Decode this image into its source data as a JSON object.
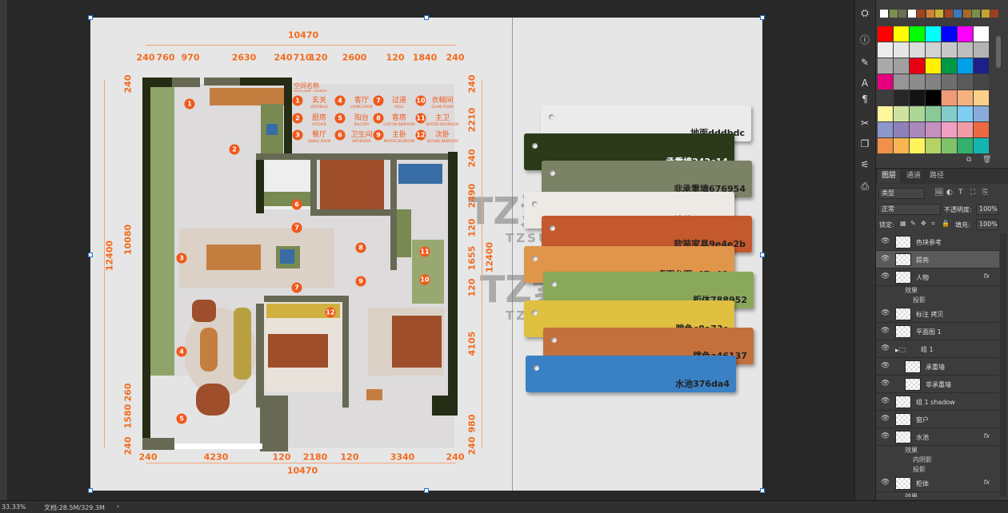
{
  "status_bar": {
    "zoom": "33.33%",
    "doc_size": "文档:28.5M/329.3M"
  },
  "plan": {
    "dims_top_total": "10470",
    "dims_top": [
      "240",
      "760",
      "970",
      "2630",
      "240",
      "710",
      "120",
      "2600",
      "120",
      "1840",
      "240"
    ],
    "dims_bottom_total": "10470",
    "dims_bottom": [
      "240",
      "4230",
      "120",
      "2180",
      "120",
      "3340",
      "240"
    ],
    "dims_left_total": "12400",
    "dims_left": [
      "240",
      "10080",
      "260",
      "1580",
      "240"
    ],
    "dims_right_total": "12400",
    "dims_right": [
      "240",
      "2210",
      "240",
      "2490",
      "120",
      "1655",
      "120",
      "4105",
      "980",
      "240"
    ],
    "room_numbers": [
      "1",
      "2",
      "3",
      "4",
      "5",
      "6",
      "7",
      "7",
      "8",
      "9",
      "10",
      "11",
      "12"
    ],
    "legend": {
      "title": "空间名称",
      "subtitle": "SPACE NAME / NUMBER",
      "items": [
        {
          "n": "1",
          "cn": "玄关",
          "en": "VESTIBULE"
        },
        {
          "n": "4",
          "cn": "客厅",
          "en": "LIVING ROOM"
        },
        {
          "n": "7",
          "cn": "过道",
          "en": "AISLE"
        },
        {
          "n": "10",
          "cn": "衣帽间",
          "en": "CLOAK ROOM"
        },
        {
          "n": "2",
          "cn": "厨房",
          "en": "KITCHEN"
        },
        {
          "n": "5",
          "cn": "阳台",
          "en": "BALCONY"
        },
        {
          "n": "8",
          "cn": "客房",
          "en": "CUSTOM BEDROOM"
        },
        {
          "n": "11",
          "cn": "主卫",
          "en": "MASTER BATHROOM"
        },
        {
          "n": "3",
          "cn": "餐厅",
          "en": "DINING ROOM"
        },
        {
          "n": "6",
          "cn": "卫生间",
          "en": "BATHROOM"
        },
        {
          "n": "9",
          "cn": "主卧",
          "en": "MASTER BEDROOM"
        },
        {
          "n": "12",
          "cn": "次卧",
          "en": "SECOND BEDROOM"
        }
      ]
    }
  },
  "swatch_cards": [
    {
      "label": "地面dddbdc",
      "color": "#ebebeb",
      "text": "#222"
    },
    {
      "label": "承重墙242c14",
      "color": "#2c3a1a",
      "text": "#fff"
    },
    {
      "label": "非承重墙676954",
      "color": "#7b8265",
      "text": "#222"
    },
    {
      "label": "地毯dbd1c7",
      "color": "#ede9e5",
      "text": "#222"
    },
    {
      "label": "软装家具9e4e2b",
      "color": "#c4592d",
      "text": "#222"
    },
    {
      "label": "桌面台面c47e40",
      "color": "#e0964a",
      "text": "#222"
    },
    {
      "label": "柜体788952",
      "color": "#8aa85a",
      "text": "#222"
    },
    {
      "label": "跳色c8a73c",
      "color": "#e0c040",
      "text": "#222"
    },
    {
      "label": "跳色a46137",
      "color": "#c4703d",
      "text": "#222"
    },
    {
      "label": "水池376da4",
      "color": "#3a80c4",
      "text": "#222"
    }
  ],
  "watermark": {
    "logo": "TZ素材网",
    "url": "TZSUCAI.COM"
  },
  "recent_swatches": [
    "#ffffff",
    "#7a8f4e",
    "#6b6f55",
    "#ffffff",
    "#a0461e",
    "#d0823a",
    "#d0b030",
    "#a04420",
    "#3a78c0",
    "#a86828",
    "#7a9048",
    "#c8a030",
    "#9e4020"
  ],
  "swatches": [
    "#ff0000",
    "#ffff00",
    "#00ff00",
    "#00ffff",
    "#0000ff",
    "#ff00ff",
    "#ffffff",
    "#ececec",
    "#e6e6e6",
    "#dcdcdc",
    "#d2d2d2",
    "#c8c8c8",
    "#bebebe",
    "#b4b4b4",
    "#aaaaaa",
    "#a0a0a0",
    "#e60012",
    "#fff100",
    "#009944",
    "#00a0e9",
    "#1d2088",
    "#e4007f",
    "#969696",
    "#8c8c8c",
    "#828282",
    "#6e6e6e",
    "#5a5a5a",
    "#464646",
    "#3c3c3c",
    "#282828",
    "#141414",
    "#000000",
    "#f19b76",
    "#f6b27e",
    "#fad08a",
    "#fff69a",
    "#cfe3a0",
    "#acd598",
    "#89c997",
    "#84ccc9",
    "#7ecef4",
    "#88abda",
    "#8c97cb",
    "#8f82bc",
    "#aa89bd",
    "#c490bf",
    "#f29fc5",
    "#f19ca7",
    "#ec6941",
    "#f19149",
    "#f8b551",
    "#fff45c",
    "#b3d465",
    "#80c269",
    "#32b16c",
    "#13b5b1"
  ],
  "tools": [
    "3d-icon",
    "info-icon",
    "brush-icon",
    "character-icon",
    "paragraph-icon",
    "tool-presets-icon",
    "layer-comps-icon",
    "properties-icon",
    "clone-source-icon"
  ],
  "layers_panel": {
    "tabs": [
      "图层",
      "通道",
      "路径"
    ],
    "filter": "类型",
    "blend_mode": "正常",
    "opacity_label": "不透明度:",
    "opacity": "100%",
    "lock_label": "锁定:",
    "fill_label": "填充:",
    "fill": "100%",
    "fx": "fx",
    "layers": [
      {
        "name": "色块参考",
        "fx": false
      },
      {
        "name": "提亮",
        "fx": false,
        "selected": true
      },
      {
        "name": "人物",
        "fx": true,
        "effects": [
          "效果",
          "投影"
        ]
      },
      {
        "name": "标注 拷贝",
        "fx": false
      },
      {
        "name": "平面图 1",
        "fx": false
      },
      {
        "name": "组 1",
        "group": true
      },
      {
        "name": "承重墙",
        "indent": true
      },
      {
        "name": "非承重墙",
        "indent": true
      },
      {
        "name": "组 1 shadow"
      },
      {
        "name": "窗户"
      },
      {
        "name": "水池",
        "fx": true,
        "effects": [
          "效果",
          "内阴影",
          "投影"
        ]
      },
      {
        "name": "柜体",
        "fx": true,
        "effects": [
          "效果"
        ]
      }
    ]
  }
}
